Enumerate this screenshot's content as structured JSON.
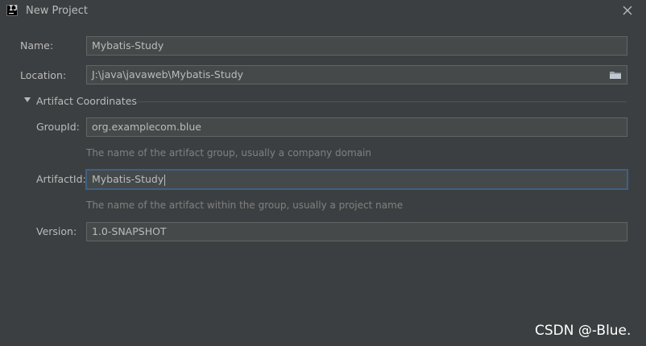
{
  "window": {
    "title": "New Project",
    "app_icon_text": "IJ"
  },
  "form": {
    "name": {
      "label": "Name:",
      "value": "Mybatis-Study"
    },
    "location": {
      "label": "Location:",
      "value": "J:\\java\\javaweb\\Mybatis-Study"
    },
    "artifact_section": {
      "label": "Artifact Coordinates",
      "expanded": true,
      "group_id": {
        "label": "GroupId:",
        "value": "org.examplecom.blue",
        "hint": "The name of the artifact group, usually a company domain"
      },
      "artifact_id": {
        "label": "ArtifactId:",
        "value": "Mybatis-Study",
        "hint": "The name of the artifact within the group, usually a project name"
      },
      "version": {
        "label": "Version:",
        "value": "1.0-SNAPSHOT"
      }
    }
  },
  "icons": {
    "app": "intellij-icon",
    "close": "close-icon",
    "browse": "folder-icon",
    "collapse": "triangle-down-icon"
  },
  "colors": {
    "background": "#3c3f41",
    "field_bg": "#45494a",
    "field_border": "#646464",
    "focus_border": "#3d6185",
    "text": "#bbbbbb",
    "hint": "#808080"
  },
  "watermark": "CSDN @-Blue."
}
